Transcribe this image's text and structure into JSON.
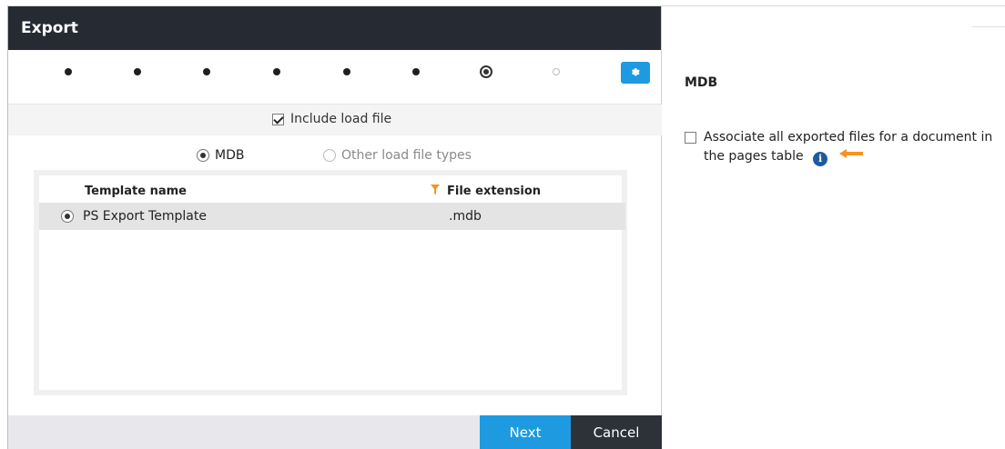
{
  "dialog": {
    "title": "Export",
    "steps": {
      "total": 9,
      "current_index": 7,
      "future_indices": [
        8
      ]
    },
    "settings_button_icon": "gear-icon",
    "include_load_file": {
      "label": "Include load file",
      "checked": true
    },
    "load_file_types": [
      {
        "label": "MDB",
        "selected": true,
        "disabled": false
      },
      {
        "label": "Other load file types",
        "selected": false,
        "disabled": true
      }
    ],
    "table": {
      "columns": [
        "Template name",
        "File extension"
      ],
      "filter_icon": "filter-icon",
      "rows": [
        {
          "selected": true,
          "name": "PS Export Template",
          "extension": ".mdb"
        }
      ]
    },
    "footer": {
      "next_label": "Next",
      "cancel_label": "Cancel"
    }
  },
  "right_panel": {
    "section_title": "MDB",
    "associate_option": {
      "checked": false,
      "label_line1": "Associate all exported files for a document in",
      "label_line2": "the pages table",
      "info_icon": "info-icon",
      "arrow_icon": "arrow-left-icon"
    }
  },
  "colors": {
    "header_bg": "#262b33",
    "accent_blue": "#1d9ae0",
    "cancel_bg": "#2d3138",
    "arrow_orange": "#f7931e",
    "info_blue": "#1f5a9e"
  }
}
